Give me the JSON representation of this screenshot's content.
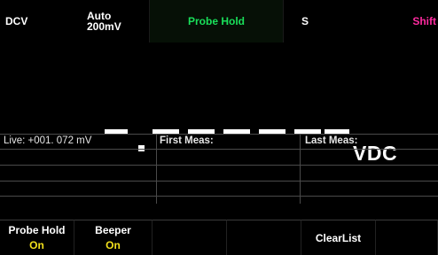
{
  "status": {
    "mode": "DCV",
    "range_top": "Auto",
    "range_bottom": "200mV",
    "hold": "Probe Hold",
    "s_indicator": "S",
    "shift": "Shift"
  },
  "display": {
    "reading": "-.------",
    "unit": "VDC"
  },
  "table": {
    "live": "Live: +001. 072 mV",
    "first_meas": "First Meas:",
    "last_meas": "Last Meas:"
  },
  "softkeys": [
    {
      "label": "Probe Hold",
      "value": "On"
    },
    {
      "label": "Beeper",
      "value": "On"
    },
    {
      "label": "",
      "value": ""
    },
    {
      "label": "",
      "value": ""
    },
    {
      "label": "ClearList",
      "value": ""
    },
    {
      "label": "",
      "value": ""
    }
  ],
  "colors": {
    "hold": "#19e05a",
    "shift": "#ff2ba0",
    "softkey_value": "#f2e01c"
  }
}
